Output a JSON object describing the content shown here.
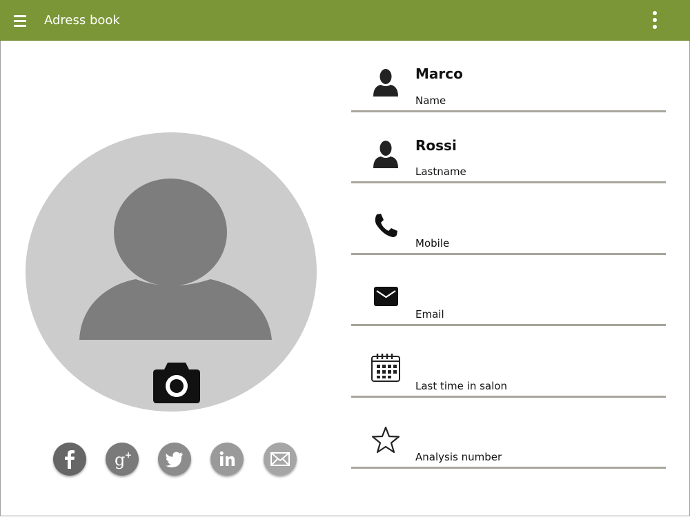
{
  "appbar": {
    "title": "Adress book",
    "menu_icon": "hamburger-menu-icon",
    "more_icon": "more-vertical-icon",
    "color": "#7b9637"
  },
  "avatar": {
    "placeholder_icon": "person-silhouette-icon",
    "camera_icon": "camera-icon"
  },
  "social": [
    {
      "name": "facebook",
      "icon": "facebook-icon",
      "color": "#666666"
    },
    {
      "name": "google-plus",
      "icon": "google-plus-icon",
      "color": "#7a7a7a"
    },
    {
      "name": "twitter",
      "icon": "twitter-icon",
      "color": "#8c8c8c"
    },
    {
      "name": "linkedin",
      "icon": "linkedin-icon",
      "color": "#9a9a9a"
    },
    {
      "name": "email",
      "icon": "mail-icon",
      "color": "#a6a6a6"
    }
  ],
  "fields": [
    {
      "key": "name",
      "icon": "person-icon",
      "value": "Marco",
      "label": "Name"
    },
    {
      "key": "lastname",
      "icon": "person-icon",
      "value": "Rossi",
      "label": "Lastname"
    },
    {
      "key": "mobile",
      "icon": "phone-icon",
      "value": "",
      "label": "Mobile"
    },
    {
      "key": "email",
      "icon": "mail-icon",
      "value": "",
      "label": "Email"
    },
    {
      "key": "last-time-in-salon",
      "icon": "calendar-icon",
      "value": "",
      "label": "Last time in salon"
    },
    {
      "key": "analysis-number",
      "icon": "star-outline-icon",
      "value": "",
      "label": "Analysis number"
    }
  ]
}
